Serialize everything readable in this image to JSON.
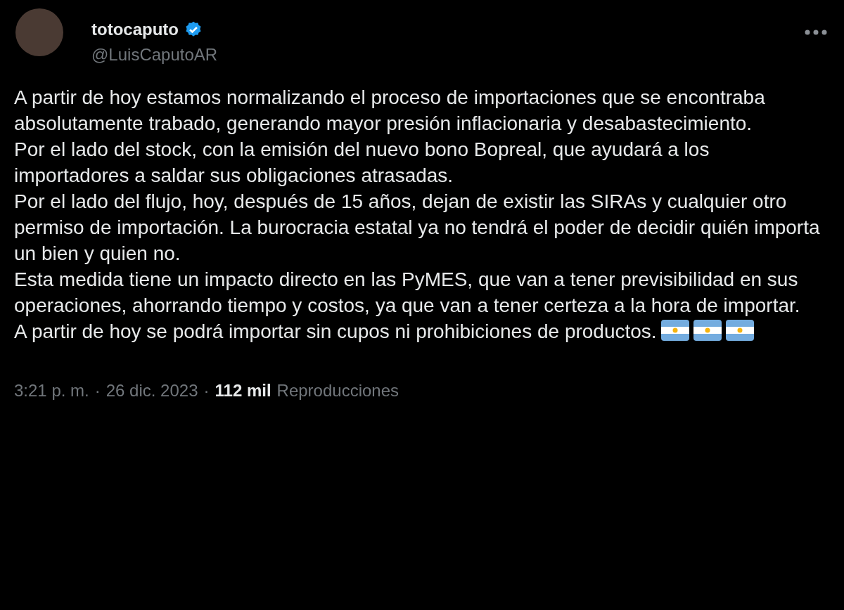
{
  "author": {
    "name": "totocaputo",
    "verified": true,
    "handle": "@LuisCaputoAR"
  },
  "paragraphs": [
    "A partir de hoy estamos normalizando el proceso de importaciones que se encontraba absolutamente trabado, generando mayor presión inflacionaria y desabastecimiento.",
    "Por el lado del stock, con la emisión del nuevo bono Bopreal, que ayudará a los importadores a saldar sus obligaciones atrasadas.",
    "Por el lado del flujo, hoy, después de 15 años, dejan de existir las SIRAs y cualquier otro permiso de importación. La burocracia estatal ya no tendrá el poder de decidir quién importa un bien y quien no.",
    "Esta medida tiene un impacto directo en las PyMES, que van a tener previsibilidad en sus operaciones, ahorrando tiempo y costos, ya que van a tener certeza a la hora de importar.",
    "A partir de hoy se podrá importar sin cupos ni prohibiciones de productos."
  ],
  "emoji": [
    {
      "kind": "argentina-flag"
    },
    {
      "kind": "argentina-flag"
    },
    {
      "kind": "argentina-flag"
    }
  ],
  "footer": {
    "time": "3:21 p. m.",
    "separator_1": "·",
    "date": "26 dic. 2023",
    "separator_2": "·",
    "views": "112 mil",
    "views_label": "Reproducciones"
  }
}
